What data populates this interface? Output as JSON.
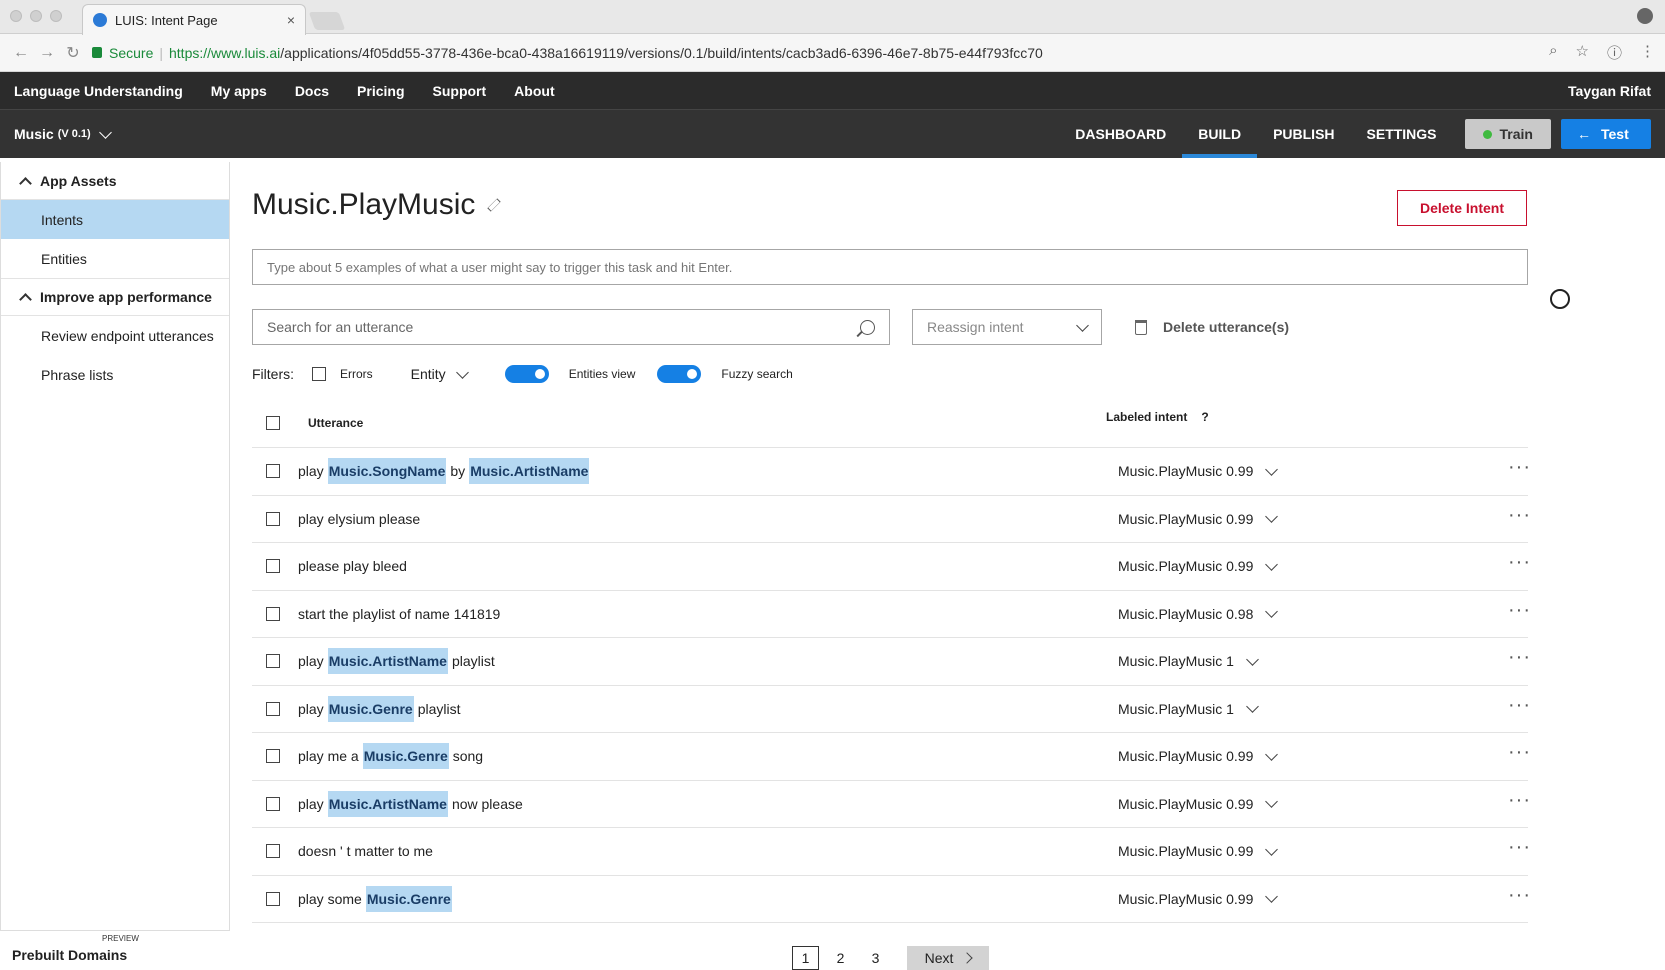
{
  "browser": {
    "tab_title": "LUIS: Intent Page",
    "tab_close": "×",
    "secure_label": "Secure",
    "url_host": "https://www.luis.ai",
    "url_path": "/applications/4f05dd55-3778-436e-bca0-438a16619119/versions/0.1/build/intents/cacb3ad6-6396-46e7-8b75-e44f793fcc70"
  },
  "topnav": {
    "items": [
      "Language Understanding",
      "My apps",
      "Docs",
      "Pricing",
      "Support",
      "About"
    ],
    "user": "Taygan Rifat"
  },
  "appbar": {
    "app_name": "Music",
    "app_version": "(V 0.1)",
    "tabs": [
      "DASHBOARD",
      "BUILD",
      "PUBLISH",
      "SETTINGS"
    ],
    "active_tab": "BUILD",
    "train_label": "Train",
    "test_label": "Test"
  },
  "sidebar": {
    "section1": "App Assets",
    "items1": [
      "Intents",
      "Entities"
    ],
    "section2": "Improve app performance",
    "items2": [
      "Review endpoint utterances",
      "Phrase lists"
    ],
    "preview_tag": "PREVIEW",
    "footer": "Prebuilt Domains"
  },
  "intent": {
    "title": "Music.PlayMusic",
    "delete_label": "Delete Intent",
    "example_placeholder": "Type about 5 examples of what a user might say to trigger this task and hit Enter."
  },
  "toolbar": {
    "search_placeholder": "Search for an utterance",
    "reassign_placeholder": "Reassign intent",
    "delete_utterances": "Delete utterance(s)"
  },
  "filters": {
    "label": "Filters:",
    "errors": "Errors",
    "entity": "Entity",
    "entities_view": "Entities view",
    "fuzzy_search": "Fuzzy search"
  },
  "table": {
    "col_utterance": "Utterance",
    "col_intent": "Labeled intent",
    "col_intent_help": "?",
    "rows": [
      {
        "parts": [
          {
            "t": "play"
          },
          {
            "t": "Music.SongName",
            "e": true
          },
          {
            "t": "by"
          },
          {
            "t": "Music.ArtistName",
            "e": true
          }
        ],
        "intent": "Music.PlayMusic 0.99"
      },
      {
        "parts": [
          {
            "t": "play elysium please"
          }
        ],
        "intent": "Music.PlayMusic 0.99"
      },
      {
        "parts": [
          {
            "t": "please play bleed"
          }
        ],
        "intent": "Music.PlayMusic 0.99"
      },
      {
        "parts": [
          {
            "t": "start the playlist of name 141819"
          }
        ],
        "intent": "Music.PlayMusic 0.98"
      },
      {
        "parts": [
          {
            "t": "play"
          },
          {
            "t": "Music.ArtistName",
            "e": true
          },
          {
            "t": "playlist"
          }
        ],
        "intent": "Music.PlayMusic 1"
      },
      {
        "parts": [
          {
            "t": "play"
          },
          {
            "t": "Music.Genre",
            "e": true
          },
          {
            "t": "playlist"
          }
        ],
        "intent": "Music.PlayMusic 1"
      },
      {
        "parts": [
          {
            "t": "play me a"
          },
          {
            "t": "Music.Genre",
            "e": true
          },
          {
            "t": "song"
          }
        ],
        "intent": "Music.PlayMusic 0.99"
      },
      {
        "parts": [
          {
            "t": "play"
          },
          {
            "t": "Music.ArtistName",
            "e": true
          },
          {
            "t": "now please"
          }
        ],
        "intent": "Music.PlayMusic 0.99"
      },
      {
        "parts": [
          {
            "t": "doesn ' t matter to me"
          }
        ],
        "intent": "Music.PlayMusic 0.99"
      },
      {
        "parts": [
          {
            "t": "play some"
          },
          {
            "t": "Music.Genre",
            "e": true
          }
        ],
        "intent": "Music.PlayMusic 0.99"
      }
    ]
  },
  "pager": {
    "pages": [
      "1",
      "2",
      "3"
    ],
    "current": "1",
    "next": "Next"
  }
}
